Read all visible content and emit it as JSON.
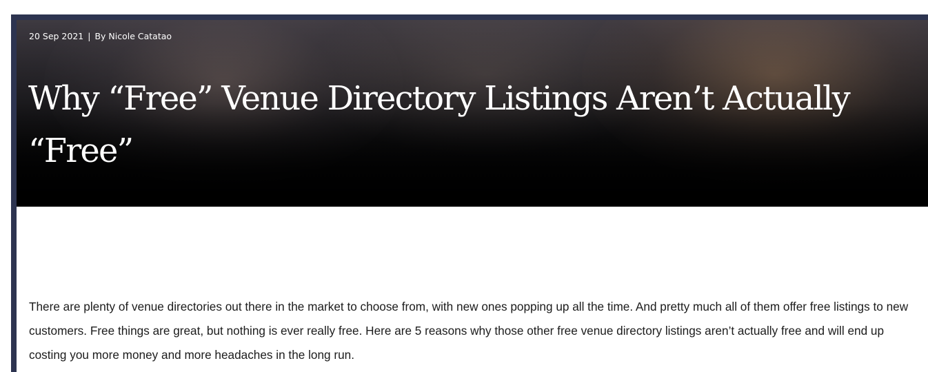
{
  "article": {
    "date": "20 Sep 2021",
    "separator": "|",
    "byline": "By Nicole Catatao",
    "title": "Why “Free” Venue Directory Listings Aren’t Actually “Free”",
    "intro": "There are plenty of venue directories out there in the market to choose from, with new ones popping up all the time. And pretty much all of them offer free listings to new customers. Free things are great, but nothing is ever really free. Here are 5 reasons why those other free venue directory listings aren’t actually free and will end up costing you more money and more headaches in the long run."
  },
  "colors": {
    "frame": "#2d3450",
    "hero_text": "#ffffff",
    "body_text": "#1c1c1c"
  }
}
